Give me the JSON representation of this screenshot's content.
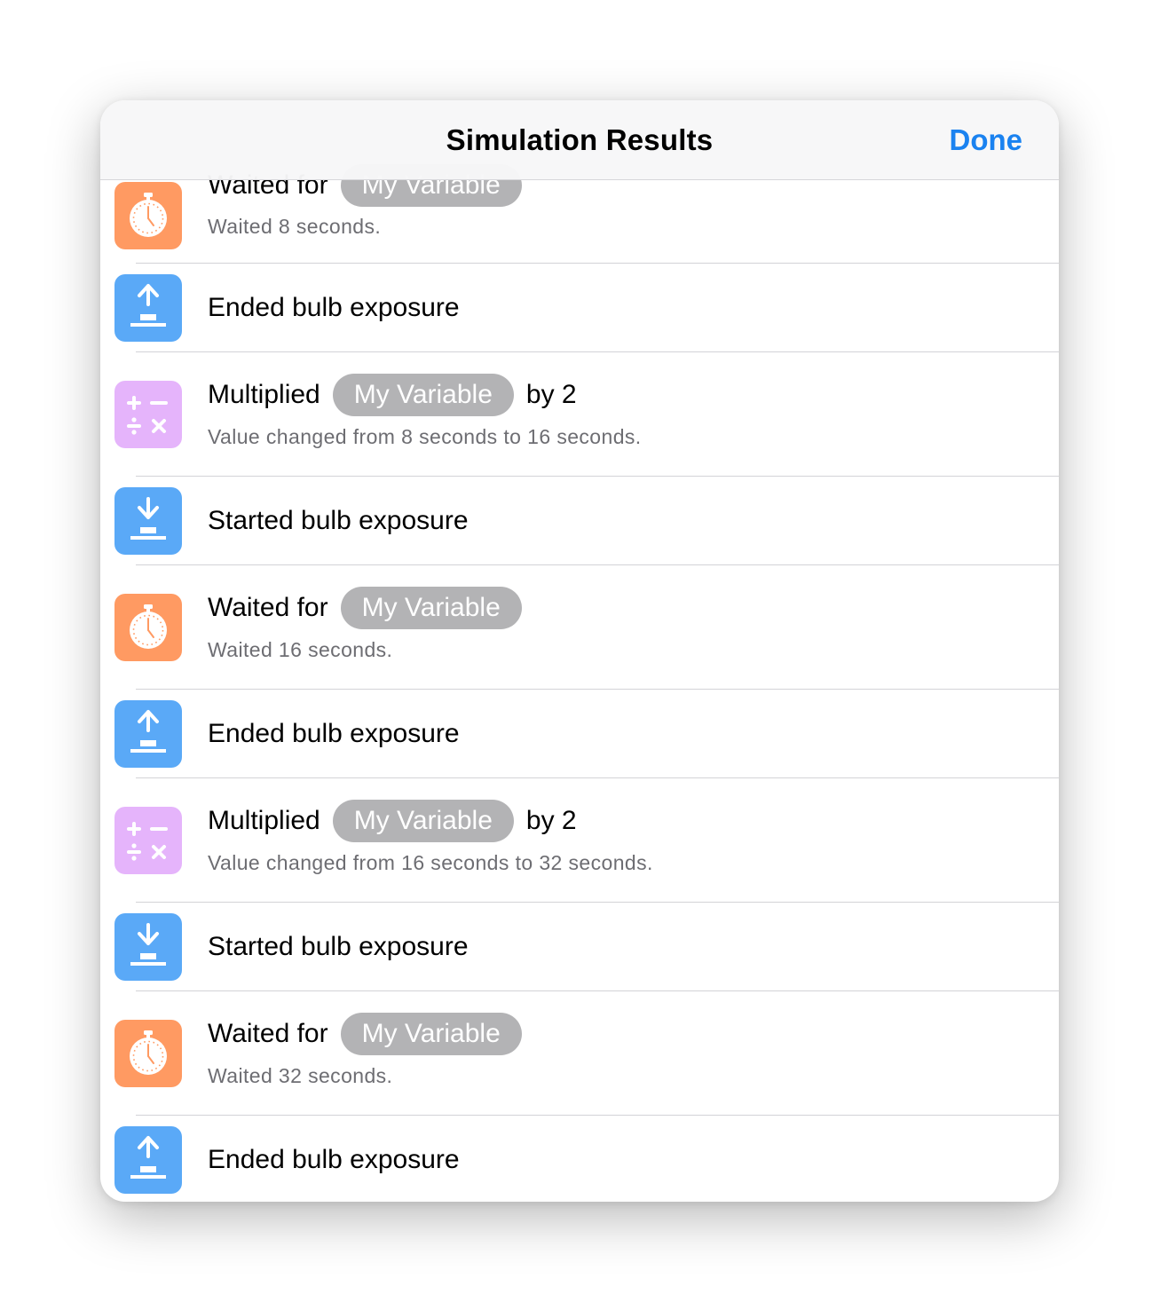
{
  "nav": {
    "title": "Simulation Results",
    "done_label": "Done"
  },
  "colors": {
    "accent": "#1a82f0",
    "wait_icon": "#ff9a62",
    "exposure_icon": "#5aa9f7",
    "math_icon": "#e5b4fb",
    "pill": "#b3b3b5"
  },
  "rows": [
    {
      "icon": "stopwatch-icon",
      "action": "Waited for",
      "variable": "My Variable",
      "detail": "Waited 8 seconds."
    },
    {
      "icon": "upload-arrow-icon",
      "action": "Ended bulb exposure"
    },
    {
      "icon": "calculator-icon",
      "action": "Multiplied",
      "variable": "My Variable",
      "suffix": "by 2",
      "detail": "Value changed from 8 seconds to 16 seconds."
    },
    {
      "icon": "download-arrow-icon",
      "action": "Started bulb exposure"
    },
    {
      "icon": "stopwatch-icon",
      "action": "Waited for",
      "variable": "My Variable",
      "detail": "Waited 16 seconds."
    },
    {
      "icon": "upload-arrow-icon",
      "action": "Ended bulb exposure"
    },
    {
      "icon": "calculator-icon",
      "action": "Multiplied",
      "variable": "My Variable",
      "suffix": "by 2",
      "detail": "Value changed from 16 seconds to 32 seconds."
    },
    {
      "icon": "download-arrow-icon",
      "action": "Started bulb exposure"
    },
    {
      "icon": "stopwatch-icon",
      "action": "Waited for",
      "variable": "My Variable",
      "detail": "Waited 32 seconds."
    },
    {
      "icon": "upload-arrow-icon",
      "action": "Ended bulb exposure"
    }
  ]
}
